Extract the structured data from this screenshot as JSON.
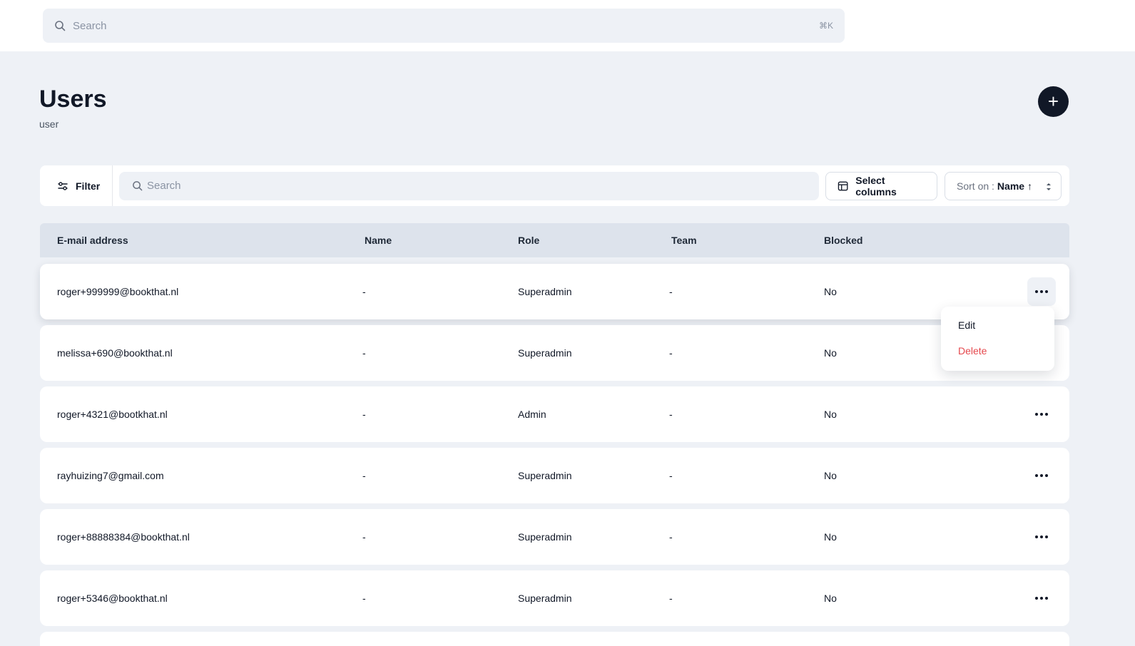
{
  "topbar": {
    "search_placeholder": "Search",
    "shortcut": "⌘K"
  },
  "page": {
    "title": "Users",
    "subtitle": "user",
    "add_label": "+"
  },
  "toolbar": {
    "filter_label": "Filter",
    "search_placeholder": "Search",
    "select_columns_label": "Select columns",
    "sort_prefix": "Sort on :",
    "sort_value": "Name ↑"
  },
  "table": {
    "columns": [
      "E-mail address",
      "Name",
      "Role",
      "Team",
      "Blocked"
    ],
    "rows": [
      {
        "email": "roger+999999@bookthat.nl",
        "name": "-",
        "role": "Superadmin",
        "team": "-",
        "blocked": "No"
      },
      {
        "email": "melissa+690@bookthat.nl",
        "name": "-",
        "role": "Superadmin",
        "team": "-",
        "blocked": "No"
      },
      {
        "email": "roger+4321@bootkhat.nl",
        "name": "-",
        "role": "Admin",
        "team": "-",
        "blocked": "No"
      },
      {
        "email": "rayhuizing7@gmail.com",
        "name": "-",
        "role": "Superadmin",
        "team": "-",
        "blocked": "No"
      },
      {
        "email": "roger+88888384@bookthat.nl",
        "name": "-",
        "role": "Superadmin",
        "team": "-",
        "blocked": "No"
      },
      {
        "email": "roger+5346@bookthat.nl",
        "name": "-",
        "role": "Superadmin",
        "team": "-",
        "blocked": "No"
      }
    ]
  },
  "context_menu": {
    "edit_label": "Edit",
    "delete_label": "Delete"
  },
  "colors": {
    "background": "#eef1f6",
    "accent_dark": "#111827",
    "danger": "#e5484d",
    "header_bg": "#dde3ec"
  },
  "icons": {
    "global_search": "search-icon",
    "filter": "sliders-icon",
    "table_search": "search-icon",
    "select_columns": "table-columns-icon",
    "sort": "chevron-up-down-icon",
    "row_actions": "more-horizontal-icon",
    "add": "plus-icon"
  }
}
